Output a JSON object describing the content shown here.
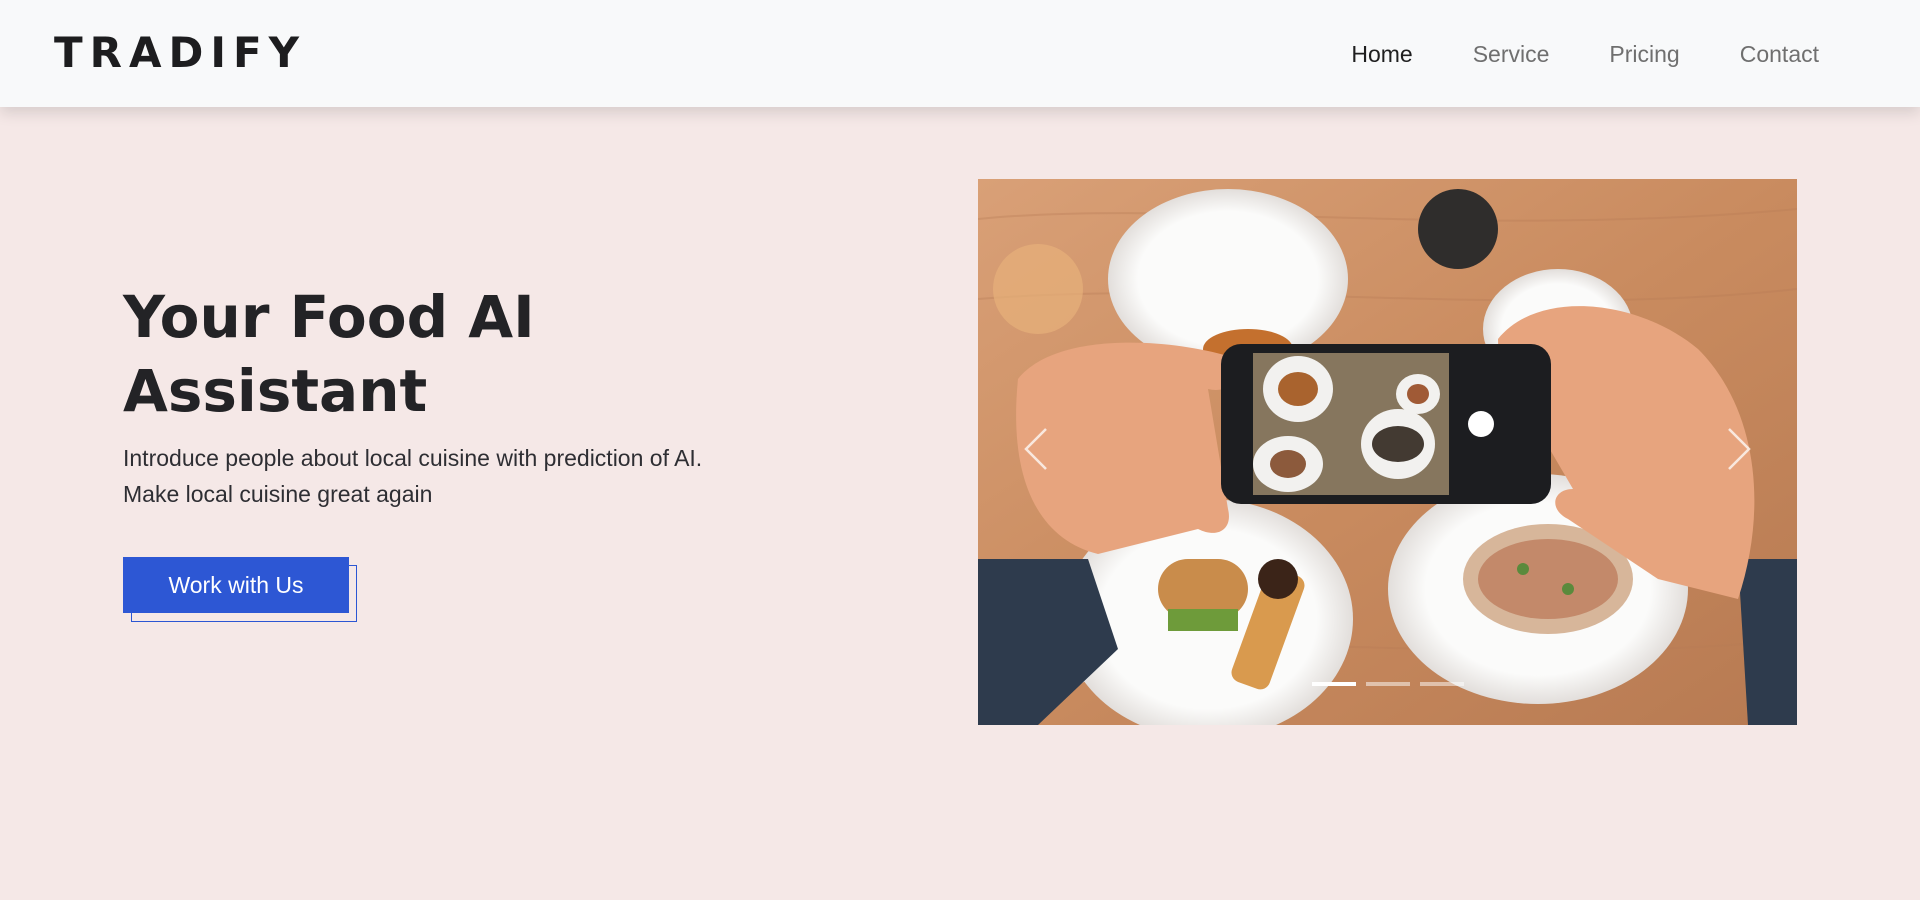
{
  "brand": {
    "logo_text": "TRADIFY"
  },
  "nav": {
    "items": [
      {
        "label": "Home",
        "active": true
      },
      {
        "label": "Service",
        "active": false
      },
      {
        "label": "Pricing",
        "active": false
      },
      {
        "label": "Contact",
        "active": false
      }
    ]
  },
  "hero": {
    "title_line1": "Your Food AI",
    "title_line2": "Assistant",
    "description_line1": "Introduce people about local cuisine with prediction of AI.",
    "description_line2": "Make local cuisine great again",
    "cta_label": "Work with Us"
  },
  "carousel": {
    "slide_count": 3,
    "active_index": 0,
    "prev_icon": "chevron-left-icon",
    "next_icon": "chevron-right-icon"
  },
  "colors": {
    "page_background": "#f5e8e7",
    "header_background": "#f8f9fa",
    "accent": "#2d57d4",
    "heading_text": "#232326"
  }
}
